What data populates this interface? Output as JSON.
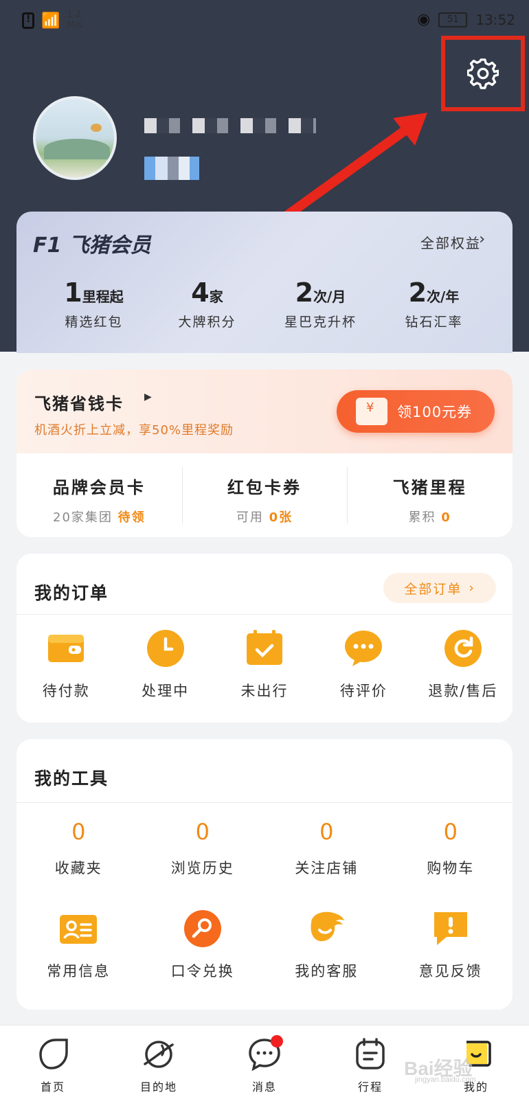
{
  "status_bar": {
    "speed_value": "1.2",
    "speed_unit": "M/s",
    "battery": "51",
    "time": "13:52"
  },
  "vip": {
    "logo": "F1 飞猪会员",
    "all_benefits": "全部权益",
    "stats": [
      {
        "value": "1",
        "unit": "里程起",
        "desc": "精选红包"
      },
      {
        "value": "4",
        "unit": "家",
        "desc": "大牌积分"
      },
      {
        "value": "2",
        "unit": "次/月",
        "desc": "星巴克升杯"
      },
      {
        "value": "2",
        "unit": "次/年",
        "desc": "钻石汇率"
      }
    ]
  },
  "savings": {
    "title": "飞猪省钱卡",
    "subtitle": "机酒火折上立减，享50%里程奖励",
    "coupon_button": "领100元券",
    "items": [
      {
        "title": "品牌会员卡",
        "sub": "20家集团",
        "highlight": "待领"
      },
      {
        "title": "红包卡券",
        "sub": "可用",
        "highlight": "0张"
      },
      {
        "title": "飞猪里程",
        "sub": "累积",
        "highlight": "0"
      }
    ]
  },
  "orders": {
    "title": "我的订单",
    "all_label": "全部订单",
    "items": [
      {
        "label": "待付款",
        "icon": "wallet-icon"
      },
      {
        "label": "处理中",
        "icon": "clock-icon"
      },
      {
        "label": "未出行",
        "icon": "calendar-check-icon"
      },
      {
        "label": "待评价",
        "icon": "chat-dots-icon"
      },
      {
        "label": "退款/售后",
        "icon": "refund-icon"
      }
    ]
  },
  "tools": {
    "title": "我的工具",
    "counts": [
      {
        "value": "0",
        "label": "收藏夹"
      },
      {
        "value": "0",
        "label": "浏览历史"
      },
      {
        "value": "0",
        "label": "关注店铺"
      },
      {
        "value": "0",
        "label": "购物车"
      }
    ],
    "items": [
      {
        "label": "常用信息",
        "icon": "contact-card-icon"
      },
      {
        "label": "口令兑换",
        "icon": "key-icon"
      },
      {
        "label": "我的客服",
        "icon": "service-wing-icon"
      },
      {
        "label": "意见反馈",
        "icon": "feedback-icon"
      }
    ]
  },
  "bottom_nav": [
    {
      "label": "首页",
      "icon": "home-leaf-icon"
    },
    {
      "label": "目的地",
      "icon": "planet-icon"
    },
    {
      "label": "消息",
      "icon": "message-icon"
    },
    {
      "label": "行程",
      "icon": "itinerary-icon"
    },
    {
      "label": "我的",
      "icon": "profile-icon"
    }
  ],
  "watermark": {
    "main": "Bai经验",
    "sub": "jingyan.baidu.com"
  },
  "colors": {
    "header_bg": "#343b4b",
    "accent_orange": "#f08a16",
    "coupon_red": "#f5612e",
    "highlight_red": "#e02a1c"
  }
}
